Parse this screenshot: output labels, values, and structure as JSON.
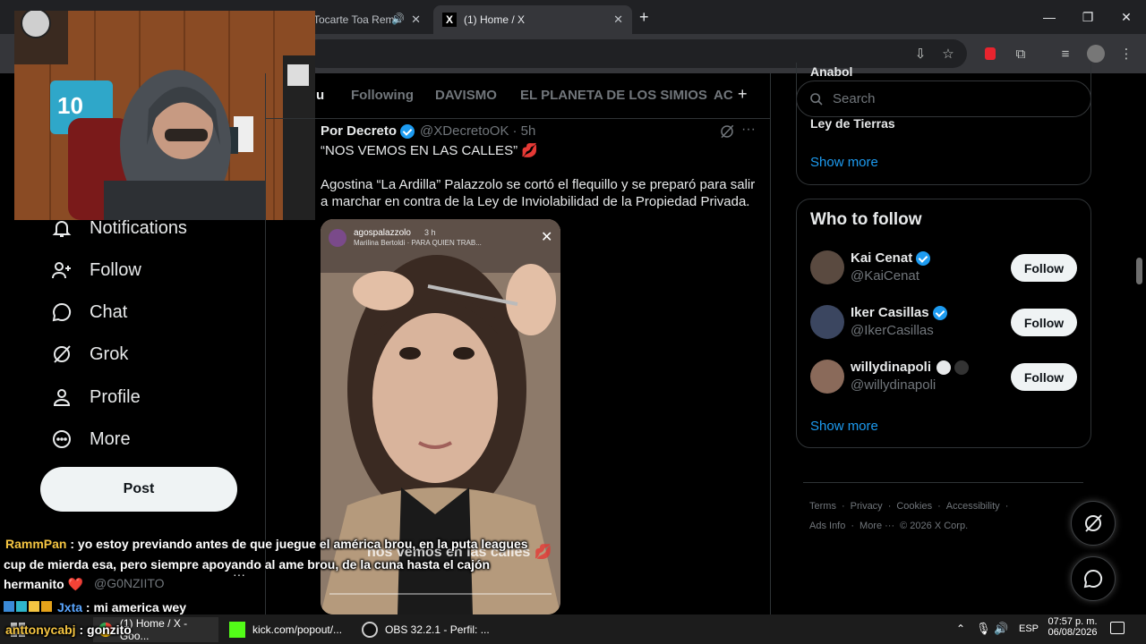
{
  "browser": {
    "tabs": [
      {
        "title": "Tocarte Toa Rem"
      },
      {
        "title": "(1) Home / X"
      }
    ],
    "new_tab": "+",
    "close_glyph": "✕",
    "window_controls": [
      "—",
      "❐",
      "✕"
    ]
  },
  "feed_tabs": [
    "u",
    "Following",
    "DAVISMO",
    "EL PLANETA DE LOS SIMIOS",
    "AC",
    "+"
  ],
  "nav": {
    "items": [
      {
        "label": "Notifications",
        "icon": "bell-icon"
      },
      {
        "label": "Follow",
        "icon": "person-plus-icon"
      },
      {
        "label": "Chat",
        "icon": "chat-bubble-icon"
      },
      {
        "label": "Grok",
        "icon": "grok-icon"
      },
      {
        "label": "Profile",
        "icon": "person-icon"
      },
      {
        "label": "More",
        "icon": "more-circle-icon"
      }
    ],
    "post_label": "Post"
  },
  "tweet": {
    "author": "Por Decreto",
    "handle": "@XDecretoOK",
    "time": "· 5h",
    "line1": "“NOS VEMOS EN LAS CALLES” 💋",
    "body": "Agostina “La Ardilla” Palazzolo se cortó el flequillo y se preparó para salir a marchar en contra de la Ley de Inviolabilidad de la Propiedad Privada.",
    "media": {
      "story_user": "agospalazzolo",
      "story_time": "3 h",
      "story_song": "Marilina Bertoldi · PARA QUIEN TRAB...",
      "caption": "nos vemos en las calles 💋"
    }
  },
  "right": {
    "search_placeholder": "Search",
    "trend_partial": "Ley de Tierras",
    "trend_top_partial": "Anabol",
    "show_more": "Show more",
    "who_to_follow_title": "Who to follow",
    "follow_label": "Follow",
    "suggestions": [
      {
        "name": "Kai Cenat",
        "handle": "@KaiCenat",
        "verified": true
      },
      {
        "name": "Iker Casillas",
        "handle": "@IkerCasillas",
        "verified": true
      },
      {
        "name": "willydinapoli",
        "handle": "@willydinapoli",
        "verified": false
      }
    ],
    "footer": [
      "Terms",
      "Privacy",
      "Cookies",
      "Accessibility",
      "Ads Info",
      "More ···",
      "© 2026 X Corp."
    ]
  },
  "chat": [
    {
      "user": "RammPan",
      "user_color": "#f5c542",
      "text": "yo estoy previando antes de que juegue el américa brou, en la puta leagues"
    },
    {
      "user": "",
      "user_color": "#ffffff",
      "text": "cup de mierda esa, pero siempre apoyando al ame brou, de la cuna hasta el cajón"
    },
    {
      "user": "",
      "user_color": "#ffffff",
      "text": "hermanito ❤️"
    },
    {
      "user": "Jxta",
      "user_color": "#5aa6ff",
      "text": "mi america wey"
    },
    {
      "user": "anttonycabj",
      "user_color": "#f5c542",
      "text": "gonzito"
    }
  ],
  "bg_partial": {
    "handle": "@G0NZIITO"
  },
  "taskbar": {
    "apps": [
      {
        "label": "(1) Home / X - Goo..."
      },
      {
        "label": "kick.com/popout/..."
      },
      {
        "label": "OBS 32.2.1 - Perfil: ..."
      }
    ],
    "lang": "ESP",
    "time": "07:57 p. m.",
    "date": "06/08/2026"
  },
  "colors": {
    "accent": "#1d9bf0",
    "bg": "#000000",
    "border": "#2f3336"
  }
}
